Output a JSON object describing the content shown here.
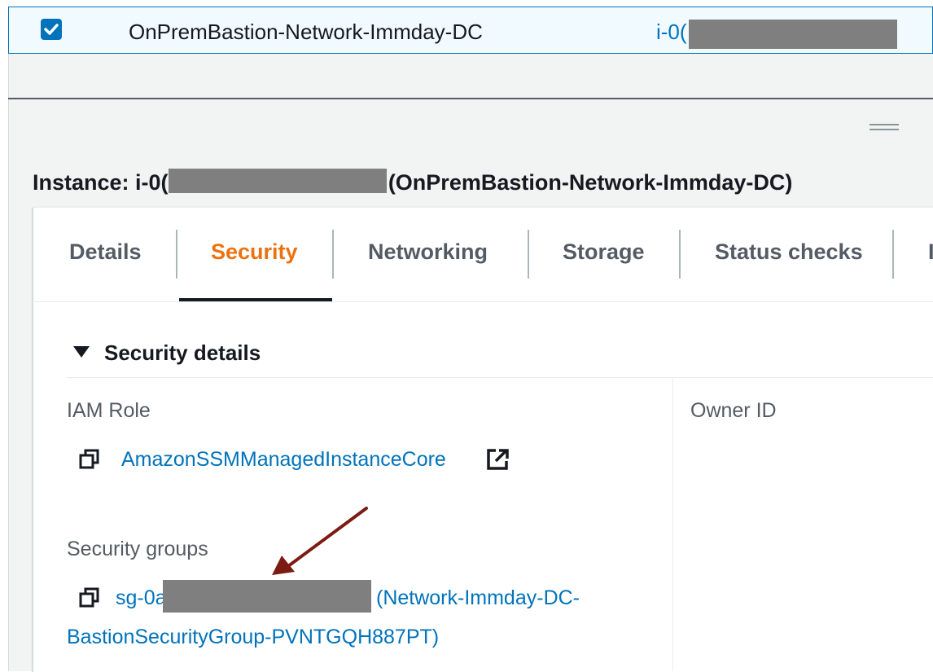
{
  "selected_row": {
    "name": "OnPremBastion-Network-Immday-DC",
    "instance_id_visible": "i-0("
  },
  "instance_header": {
    "prefix": "Instance: i-0(",
    "suffix": "(OnPremBastion-Network-Immday-DC)"
  },
  "tabs": [
    {
      "label": "Details",
      "active": false
    },
    {
      "label": "Security",
      "active": true
    },
    {
      "label": "Networking",
      "active": false
    },
    {
      "label": "Storage",
      "active": false
    },
    {
      "label": "Status checks",
      "active": false
    },
    {
      "label": "I",
      "active": false
    }
  ],
  "security_details": {
    "title": "Security details",
    "iam_role_label": "IAM Role",
    "iam_role_value": "AmazonSSMManagedInstanceCore",
    "owner_id_label": "Owner ID",
    "security_groups_label": "Security groups",
    "security_group_prefix": "sg-0a",
    "security_group_name_line1": "(Network-Immday-DC-",
    "security_group_name_line2": "BastionSecurityGroup-PVNTGQH887PT)"
  },
  "colors": {
    "accent_active_tab": "#ec7211",
    "link": "#0073bb",
    "annotation_arrow": "#7b1b12",
    "redaction": "#7f7f7f"
  },
  "icons": [
    "checkbox-checked-icon",
    "drag-handle-icon",
    "caret-down-icon",
    "copy-icon",
    "external-link-icon"
  ]
}
